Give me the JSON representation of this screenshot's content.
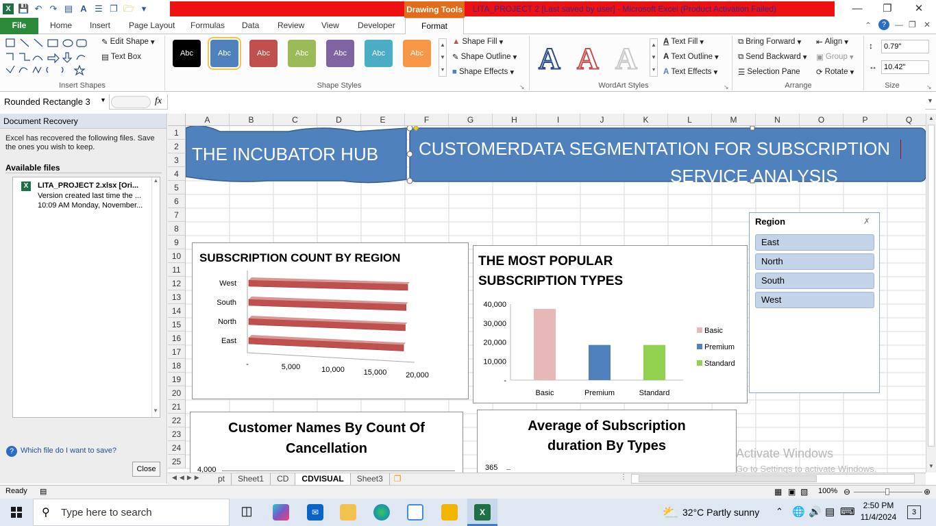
{
  "titlebar": {
    "contextual_tab_group": "Drawing Tools",
    "window_title": "LITA_PROJECT 2 [Last saved by user] -  Microsoft Excel (Product Activation Failed)"
  },
  "tabs": [
    "File",
    "Home",
    "Insert",
    "Page Layout",
    "Formulas",
    "Data",
    "Review",
    "View",
    "Developer",
    "Format"
  ],
  "ribbon": {
    "insert_shapes": {
      "label": "Insert Shapes",
      "edit_shape": "Edit Shape",
      "text_box": "Text Box"
    },
    "shape_styles": {
      "label": "Shape Styles",
      "sample_text": "Abc",
      "shape_fill": "Shape Fill",
      "shape_outline": "Shape Outline",
      "shape_effects": "Shape Effects"
    },
    "wordart": {
      "label": "WordArt Styles",
      "letter": "A",
      "text_fill": "Text Fill",
      "text_outline": "Text Outline",
      "text_effects": "Text Effects"
    },
    "arrange": {
      "label": "Arrange",
      "bring_forward": "Bring Forward",
      "send_backward": "Send Backward",
      "selection_pane": "Selection Pane",
      "align": "Align",
      "group": "Group",
      "rotate": "Rotate"
    },
    "size": {
      "label": "Size",
      "height": "0.79\"",
      "width": "10.42\""
    }
  },
  "formula_bar": {
    "name_box": "Rounded Rectangle 3",
    "fx": "fx",
    "content": ""
  },
  "doc_recovery": {
    "title": "Document Recovery",
    "description": "Excel has recovered the following files.  Save the ones you wish to keep.",
    "available_files": "Available files",
    "file_name": "LITA_PROJECT 2.xlsx  [Ori...",
    "file_line2": "Version created last time the ...",
    "file_line3": "10:09 AM Monday, November...",
    "help_link": "Which file do I want to save?",
    "close": "Close"
  },
  "grid": {
    "columns": [
      "A",
      "B",
      "C",
      "D",
      "E",
      "F",
      "G",
      "H",
      "I",
      "J",
      "K",
      "L",
      "M",
      "N",
      "O",
      "P",
      "Q"
    ],
    "rows": [
      "1",
      "2",
      "3",
      "4",
      "5",
      "6",
      "7",
      "8",
      "9",
      "10",
      "11",
      "12",
      "13",
      "14",
      "15",
      "16",
      "17",
      "18",
      "19",
      "20",
      "21",
      "22",
      "23",
      "24",
      "25"
    ]
  },
  "banner": {
    "left": "THE INCUBATOR HUB",
    "right_line1": "CUSTOMERDATA SEGMENTATION FOR SUBSCRIPTION",
    "right_line2": "SERVICE ANALYSIS"
  },
  "chart_data": [
    {
      "type": "bar",
      "orientation": "horizontal",
      "title": "SUBSCRIPTION COUNT BY REGION",
      "categories": [
        "West",
        "South",
        "North",
        "East"
      ],
      "values": [
        19500,
        19300,
        19200,
        19000
      ],
      "xticks": [
        "-",
        "5,000",
        "10,000",
        "15,000",
        "20,000"
      ],
      "xlim": [
        0,
        20000
      ],
      "color": "#c0504d"
    },
    {
      "type": "bar",
      "title": "THE MOST POPULAR SUBSCRIPTION TYPES",
      "categories": [
        "Basic",
        "Premium",
        "Standard"
      ],
      "values": [
        37500,
        18500,
        18500
      ],
      "yticks": [
        "-",
        "10,000",
        "20,000",
        "30,000",
        "40,000"
      ],
      "ylim": [
        0,
        40000
      ],
      "colors": [
        "#e6b9b8",
        "#4f81bd",
        "#92d050"
      ],
      "legend": [
        "Basic",
        "Premium",
        "Standard"
      ],
      "legend_position": "right"
    },
    {
      "type": "bar",
      "title_line1": "Customer Names By Count Of",
      "title_line2": "Cancellation",
      "visible_ytick": "4,000"
    },
    {
      "type": "bar",
      "title_line1": "Average of Subscription",
      "title_line2": "duration By Types",
      "visible_ytick": "365"
    }
  ],
  "slicer": {
    "title": "Region",
    "items": [
      "East",
      "North",
      "South",
      "West"
    ]
  },
  "sheet_tabs": [
    "pt",
    "Sheet1",
    "CD",
    "CDVISUAL",
    "Sheet3"
  ],
  "active_sheet": "CDVISUAL",
  "watermark": {
    "line1": "Activate Windows",
    "line2": "Go to Settings to activate Windows."
  },
  "status": {
    "ready": "Ready",
    "zoom": "100%"
  },
  "taskbar": {
    "search_placeholder": "Type here to search",
    "weather": "32°C  Partly sunny",
    "time": "2:50 PM",
    "date": "11/4/2024",
    "notifications": "3"
  }
}
